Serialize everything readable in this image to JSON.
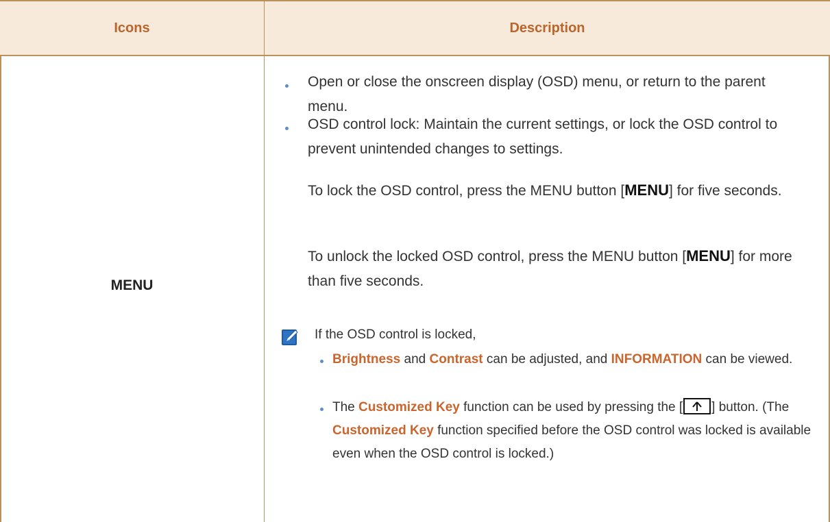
{
  "table": {
    "header": {
      "icons": "Icons",
      "description": "Description"
    },
    "row": {
      "icon_name": "MENU",
      "bullet1": "Open or close the onscreen display (OSD) menu, or return to the parent menu.",
      "bullet2": "OSD control lock: Maintain the current settings, or lock the OSD control to prevent unintended changes to settings.",
      "lock_text_pre": "To lock the OSD control, press the MENU button [",
      "lock_key": "MENU",
      "lock_text_post": "] for five seconds.",
      "unlock_text_pre": "To unlock the locked OSD control, press the MENU button [",
      "unlock_key": "MENU",
      "unlock_text_post": "] for more than five seconds.",
      "note": {
        "icon": "note-pencil-icon",
        "intro": "If the OSD control is locked,",
        "item1": {
          "brightness": "Brightness",
          "and": " and ",
          "contrast": "Contrast",
          "mid": " can be adjusted, and ",
          "information": "INFORMATION",
          "end": " can be viewed."
        },
        "item2": {
          "pre": "The ",
          "customized_key": "Customized Key",
          "mid": " function can be used by pressing the [",
          "key_icon": "up-arrow-key-icon",
          "post": "] button. (The ",
          "customized_key_2": "Customized Key",
          "end": " function specified before the OSD control was locked is available even when the OSD control is locked.)"
        }
      }
    }
  },
  "colors": {
    "accent": "#c9652d",
    "header_bg": "#f7eadb",
    "border": "#b8925a",
    "bullet": "#5a8fc7"
  }
}
